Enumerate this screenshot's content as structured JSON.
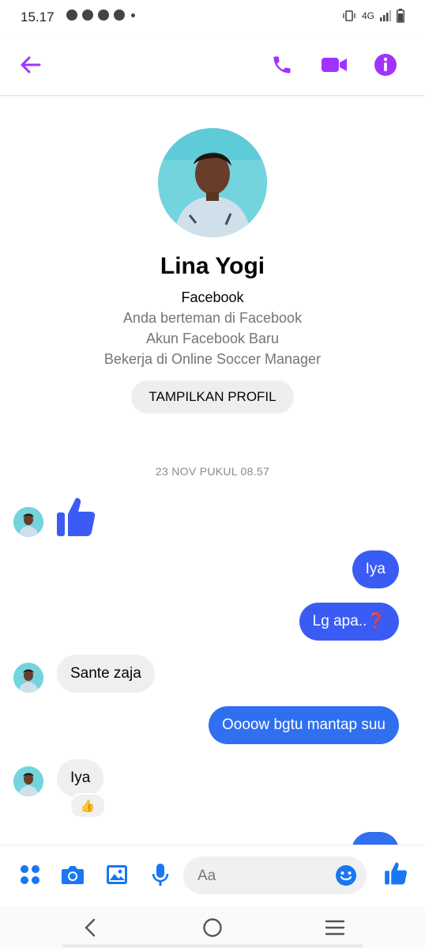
{
  "status_bar": {
    "time": "15.17",
    "network": "4G"
  },
  "header": {
    "back_icon": "arrow-left-icon",
    "actions": [
      "phone-icon",
      "video-camera-icon",
      "info-icon"
    ],
    "accent_color": "#a033ff"
  },
  "profile": {
    "name": "Lina Yogi",
    "source": "Facebook",
    "lines": [
      "Anda berteman di Facebook",
      "Akun Facebook Baru",
      "Bekerja di Online Soccer Manager"
    ],
    "button_label": "TAMPILKAN PROFIL"
  },
  "conversation": {
    "timestamp": "23 NOV PUKUL 08.57",
    "messages": [
      {
        "direction": "in",
        "type": "like-sticker",
        "icon": "thumbs-up-icon"
      },
      {
        "direction": "out",
        "text": "Iya"
      },
      {
        "direction": "out",
        "text": "Lg apa..❓"
      },
      {
        "direction": "in",
        "text": "Sante zaja"
      },
      {
        "direction": "out",
        "text": "Oooow bgtu mantap suu"
      },
      {
        "direction": "in",
        "text": "Iya",
        "reaction": "👍"
      }
    ],
    "bubble_colors": {
      "incoming": "#efefef",
      "outgoing": "#3a5cf5"
    }
  },
  "composer": {
    "icons": [
      "menu-grid-icon",
      "camera-icon",
      "gallery-icon",
      "microphone-icon"
    ],
    "placeholder": "Aa",
    "emoji_icon": "smiley-icon",
    "send_icon": "thumbs-up-icon",
    "accent_color": "#1877f2"
  },
  "system_nav": [
    "back-chevron-icon",
    "home-circle-icon",
    "recents-icon"
  ]
}
